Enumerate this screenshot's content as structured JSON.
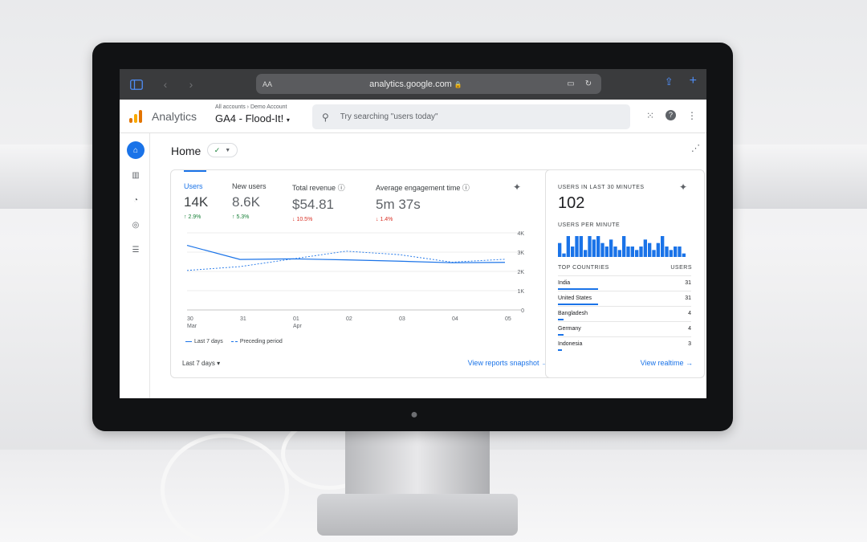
{
  "safari": {
    "text_size": "AA",
    "url": "analytics.google.com",
    "lock": "🔒"
  },
  "header": {
    "product": "Analytics",
    "breadcrumb": "All accounts › Demo Account",
    "property": "GA4 - Flood-It!",
    "search_placeholder": "Try searching \"users today\""
  },
  "page": {
    "title": "Home"
  },
  "overview": {
    "metrics": [
      {
        "label": "Users",
        "value": "14K",
        "delta": "↑ 2.9%",
        "trend": "up"
      },
      {
        "label": "New users",
        "value": "8.6K",
        "delta": "↑ 5.3%",
        "trend": "up"
      },
      {
        "label": "Total revenue",
        "value": "$54.81",
        "delta": "↓ 10.5%",
        "trend": "down"
      },
      {
        "label": "Average engagement time",
        "value": "5m 37s",
        "delta": "↓ 1.4%",
        "trend": "down"
      }
    ],
    "legend_current": "Last 7 days",
    "legend_previous": "Preceding period",
    "date_range": "Last 7 days",
    "link": "View reports snapshot"
  },
  "chart_data": {
    "type": "line",
    "x": [
      "30 Mar",
      "31",
      "01 Apr",
      "02",
      "03",
      "04",
      "05"
    ],
    "x_labels": [
      [
        "30",
        "Mar"
      ],
      [
        "31",
        ""
      ],
      [
        "01",
        "Apr"
      ],
      [
        "02",
        ""
      ],
      [
        "03",
        ""
      ],
      [
        "04",
        ""
      ],
      [
        "05",
        ""
      ]
    ],
    "y_ticks": [
      "4K",
      "3K",
      "2K",
      "1K",
      "0"
    ],
    "ylim": [
      0,
      4000
    ],
    "series": [
      {
        "name": "Last 7 days",
        "values": [
          3350,
          2620,
          2650,
          2600,
          2530,
          2450,
          2470
        ],
        "style": "solid",
        "color": "#1a73e8"
      },
      {
        "name": "Preceding period",
        "values": [
          2050,
          2250,
          2650,
          3050,
          2870,
          2480,
          2630
        ],
        "style": "dashed",
        "color": "#1a73e8"
      }
    ]
  },
  "realtime": {
    "label": "USERS IN LAST 30 MINUTES",
    "value": "102",
    "per_minute_label": "USERS PER MINUTE",
    "per_minute": [
      4,
      1,
      6,
      3,
      6,
      6,
      2,
      6,
      5,
      6,
      4,
      3,
      5,
      3,
      2,
      6,
      3,
      3,
      2,
      3,
      5,
      4,
      2,
      4,
      6,
      3,
      2,
      3,
      3,
      1
    ],
    "countries_header": "TOP COUNTRIES",
    "users_header": "USERS",
    "countries": [
      {
        "name": "India",
        "users": "31",
        "share": 1.0
      },
      {
        "name": "United States",
        "users": "31",
        "share": 1.0
      },
      {
        "name": "Bangladesh",
        "users": "4",
        "share": 0.13
      },
      {
        "name": "Germany",
        "users": "4",
        "share": 0.13
      },
      {
        "name": "Indonesia",
        "users": "3",
        "share": 0.1
      }
    ],
    "link": "View realtime"
  }
}
